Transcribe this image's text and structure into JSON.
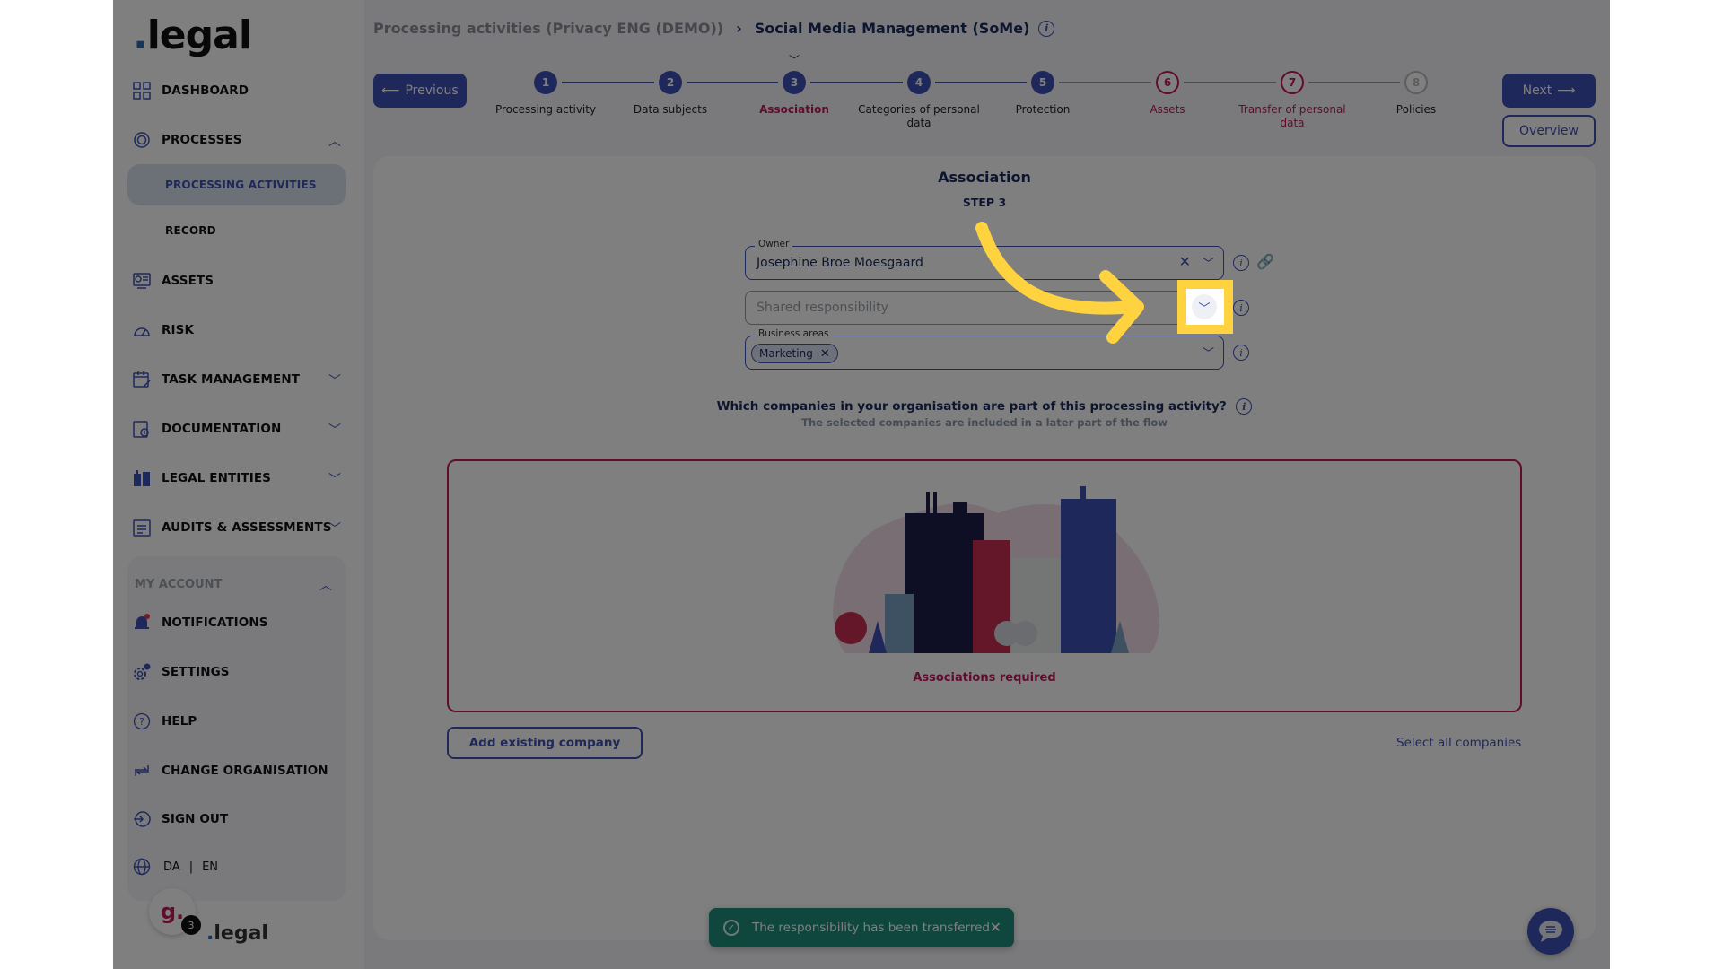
{
  "sidebar": {
    "logo": {
      "dot": ".",
      "text": "legal"
    },
    "items": [
      {
        "label": "DASHBOARD",
        "icon": "dashboard-icon"
      },
      {
        "label": "PROCESSES",
        "icon": "processes-icon",
        "expanded": true
      },
      {
        "label": "ASSETS",
        "icon": "assets-icon"
      },
      {
        "label": "RISK",
        "icon": "risk-gauge-icon"
      },
      {
        "label": "TASK MANAGEMENT",
        "icon": "task-calendar-icon",
        "expanded": false
      },
      {
        "label": "DOCUMENTATION",
        "icon": "documentation-icon",
        "expanded": false
      },
      {
        "label": "LEGAL ENTITIES",
        "icon": "buildings-icon",
        "expanded": false
      },
      {
        "label": "AUDITS & ASSESSMENTS",
        "icon": "audit-checklist-icon",
        "expanded": false
      }
    ],
    "sub_items": [
      {
        "label": "PROCESSING ACTIVITIES",
        "active": true
      },
      {
        "label": "RECORD",
        "active": false
      }
    ],
    "account": {
      "title": "MY ACCOUNT",
      "items": [
        {
          "label": "NOTIFICATIONS",
          "icon": "bell-icon",
          "has_dot": true
        },
        {
          "label": "SETTINGS",
          "icon": "gear-icon"
        },
        {
          "label": "HELP",
          "icon": "help-icon"
        },
        {
          "label": "CHANGE ORGANISATION",
          "icon": "swap-icon"
        },
        {
          "label": "SIGN OUT",
          "icon": "sign-out-icon"
        }
      ],
      "languages": [
        "DA",
        "EN"
      ],
      "language_separator": "|"
    },
    "footer": {
      "badge_letter": "g.",
      "badge_count": "3",
      "logo_dot": ".",
      "logo_text": "legal"
    }
  },
  "header": {
    "breadcrumb_parent": "Processing activities (Privacy ENG (DEMO))",
    "breadcrumb_sep": "›",
    "breadcrumb_current": "Social Media Management (SoMe)",
    "previous_label": "Previous",
    "next_label": "Next",
    "overview_label": "Overview"
  },
  "stepper": {
    "current_step": 3,
    "steps": [
      {
        "number": "1",
        "label": "Processing activity",
        "state": "done"
      },
      {
        "number": "2",
        "label": "Data subjects",
        "state": "done"
      },
      {
        "number": "3",
        "label": "Association",
        "state": "current"
      },
      {
        "number": "4",
        "label": "Categories of personal data",
        "state": "done"
      },
      {
        "number": "5",
        "label": "Protection",
        "state": "done"
      },
      {
        "number": "6",
        "label": "Assets",
        "state": "error"
      },
      {
        "number": "7",
        "label": "Transfer of personal data",
        "state": "error"
      },
      {
        "number": "8",
        "label": "Policies",
        "state": "todo"
      }
    ]
  },
  "main": {
    "title": "Association",
    "step_label": "STEP 3",
    "owner": {
      "label": "Owner",
      "value": "Josephine Broe Moesgaard"
    },
    "shared_responsibility": {
      "placeholder": "Shared responsibility"
    },
    "business_areas": {
      "label": "Business areas",
      "chips": [
        "Marketing"
      ]
    },
    "question": "Which companies in your organisation are part of this processing activity?",
    "question_sub": "The selected companies are included in a later part of the flow",
    "associations_required": "Associations required",
    "add_company_label": "Add existing company",
    "select_all_label": "Select all companies"
  },
  "toast": {
    "message": "The responsibility has been transferred",
    "type": "success"
  },
  "colors": {
    "primary": "#3f51b5",
    "error": "#c2185b",
    "navy": "#1a2b5e",
    "success": "#1e8e7e",
    "highlight": "#ffd23f"
  }
}
